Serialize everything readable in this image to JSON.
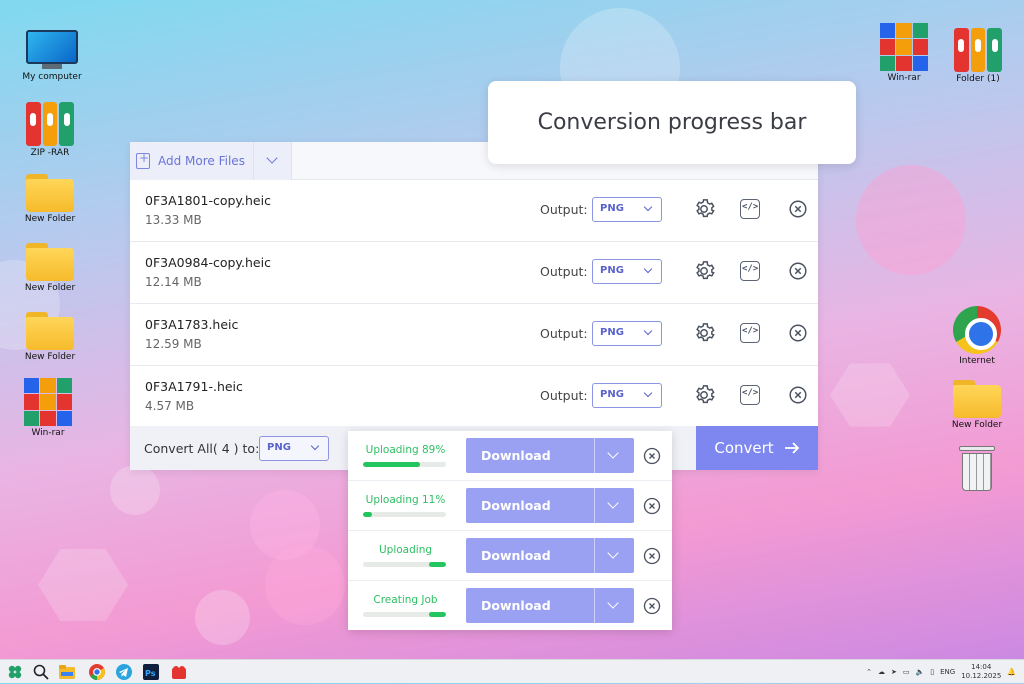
{
  "desktop": {
    "left_icons": [
      {
        "label": "My computer",
        "icon": "computer-icon"
      },
      {
        "label": "ZIP -RAR",
        "icon": "binders-icon"
      },
      {
        "label": "New Folder",
        "icon": "folder-icon"
      },
      {
        "label": "New Folder",
        "icon": "folder-icon"
      },
      {
        "label": "New Folder",
        "icon": "folder-icon"
      },
      {
        "label": "Win-rar",
        "icon": "winrar-icon"
      }
    ],
    "right_icons": [
      {
        "label": "Win-rar",
        "icon": "winrar-icon"
      },
      {
        "label": "Folder (1)",
        "icon": "binders-icon"
      },
      {
        "label": "Internet",
        "icon": "chrome-icon"
      },
      {
        "label": "New Folder",
        "icon": "folder-icon"
      },
      {
        "label": "",
        "icon": "recycle-bin-icon"
      }
    ]
  },
  "callout": {
    "text": "Conversion progress bar"
  },
  "converter": {
    "add_more_label": "Add More Files",
    "output_label": "Output:",
    "files": [
      {
        "name": "0F3A1801-copy.heic",
        "size": "13.33 MB",
        "format": "PNG"
      },
      {
        "name": "0F3A0984-copy.heic",
        "size": "12.14 MB",
        "format": "PNG"
      },
      {
        "name": "0F3A1783.heic",
        "size": "12.59 MB",
        "format": "PNG"
      },
      {
        "name": "0F3A1791-.heic",
        "size": "4.57 MB",
        "format": "PNG"
      }
    ],
    "convert_all_label": "Convert All( 4 ) to:",
    "convert_all_format": "PNG",
    "convert_button": "Convert"
  },
  "progress": {
    "items": [
      {
        "status": "Uploading 89%",
        "progress": 0.69,
        "download_label": "Download"
      },
      {
        "status": "Uploading 11%",
        "progress": 0.11,
        "download_label": "Download"
      },
      {
        "status": "Uploading",
        "progress": 0.2,
        "download_label": "Download"
      },
      {
        "status": "Creating Job",
        "progress": 0.2,
        "download_label": "Download"
      }
    ]
  },
  "taskbar": {
    "lang": "ENG",
    "time": "14:04",
    "date": "10.12.2025"
  },
  "colors": {
    "accent": "#7e87ef",
    "progress_green": "#22c55e",
    "download_button": "#9aa1f3"
  }
}
